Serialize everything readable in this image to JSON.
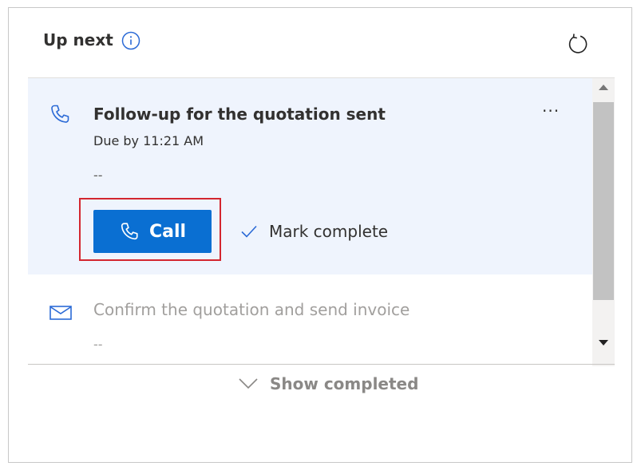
{
  "header": {
    "title": "Up next",
    "icons": [
      "info-icon",
      "refresh-icon"
    ]
  },
  "tasks": [
    {
      "icon": "phone-icon",
      "title": "Follow-up for the quotation sent",
      "due": "Due by 11:21 AM",
      "description": "--",
      "more_label": "···",
      "call_label": "Call",
      "mark_complete_label": "Mark complete",
      "state": "expanded"
    },
    {
      "icon": "mail-icon",
      "title": "Confirm the quotation and send invoice",
      "description": "--",
      "state": "collapsed"
    }
  ],
  "footer": {
    "show_completed_label": "Show completed"
  },
  "colors": {
    "accent": "#0a6fd2",
    "active_card_bg": "#eff4fd",
    "highlight_outline": "#d3262f",
    "muted_text": "#a19f9d"
  }
}
